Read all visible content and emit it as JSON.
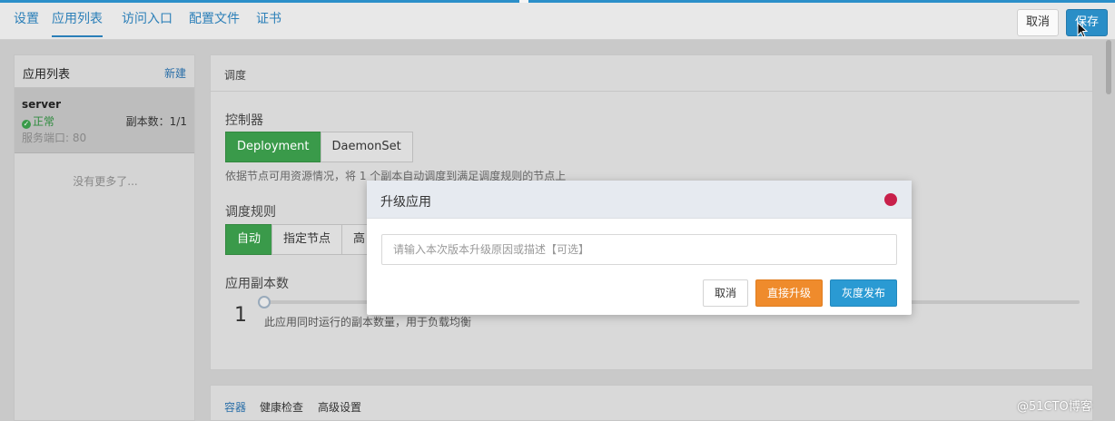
{
  "topnav": {
    "tabs": [
      {
        "label": "设置"
      },
      {
        "label": "应用列表"
      },
      {
        "label": "访问入口"
      },
      {
        "label": "配置文件"
      },
      {
        "label": "证书"
      }
    ],
    "active_tab": "应用列表",
    "cancel_label": "取消",
    "save_label": "保存"
  },
  "app_list": {
    "title": "应用列表",
    "new_label": "新建",
    "items": [
      {
        "name": "server",
        "status": "正常",
        "replicas": "副本数：1/1",
        "port": "服务端口: 80"
      }
    ],
    "empty_hint": "没有更多了..."
  },
  "schedule": {
    "title": "调度",
    "controller_label": "控制器",
    "controllers": [
      "Deployment",
      "DaemonSet"
    ],
    "controller_selected": "Deployment",
    "controller_hint": "依据节点可用资源情况，将 1 个副本自动调度到满足调度规则的节点上",
    "rule_label": "调度规则",
    "rules": [
      "自动",
      "指定节点",
      "高"
    ],
    "rule_selected": "自动",
    "replica_label": "应用副本数",
    "replica_value": "1",
    "replica_hint": "此应用同时运行的副本数量，用于负载均衡"
  },
  "bottom_tabs": {
    "tabs": [
      "容器",
      "健康检查",
      "高级设置"
    ],
    "active": "容器"
  },
  "modal": {
    "title": "升级应用",
    "input_placeholder": "请输入本次版本升级原因或描述【可选】",
    "cancel_label": "取消",
    "upgrade_label": "直接升级",
    "gray_label": "灰度发布",
    "colors": {
      "close": "#c8204a",
      "upgrade": "#ef8b2c",
      "gray_release": "#2a9ad3"
    }
  },
  "watermark": "@51CTO博客"
}
